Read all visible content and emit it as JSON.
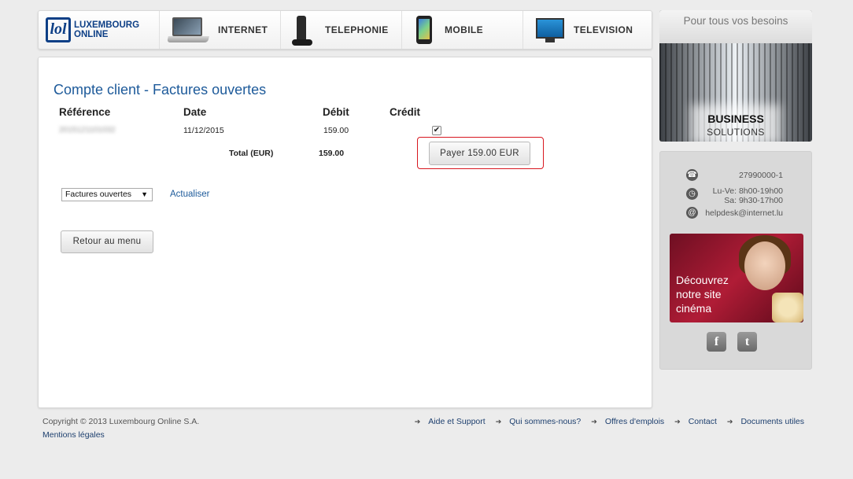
{
  "nav": {
    "logo_line1": "LUXEMBOURG",
    "logo_line2": "ONLINE",
    "logo_mark": "lol",
    "items": [
      {
        "label": "INTERNET",
        "icon": "laptop-icon"
      },
      {
        "label": "TELEPHONIE",
        "icon": "phone-icon"
      },
      {
        "label": "MOBILE",
        "icon": "mobile-icon"
      },
      {
        "label": "TELEVISION",
        "icon": "tv-icon"
      }
    ]
  },
  "main": {
    "title": "Compte client - Factures ouvertes",
    "table": {
      "headers": [
        "Référence",
        "Date",
        "Débit",
        "Crédit"
      ],
      "rows": [
        {
          "reference": "2015121101032",
          "date": "11/12/2015",
          "debit": "159.00",
          "credit_checked": true
        }
      ],
      "total_label": "Total (EUR)",
      "total_value": "159.00"
    },
    "pay_button": "Payer 159.00 EUR",
    "filter_select": "Factures ouvertes",
    "refresh_link": "Actualiser",
    "back_button": "Retour au menu"
  },
  "sidebar": {
    "banner_tagline": "Pour tous vos besoins",
    "banner_title": "BUSINESS",
    "banner_subtitle": "SOLUTIONS",
    "phone": "27990000-1",
    "hours_line1": "Lu-Ve: 8h00-19h00",
    "hours_line2": "Sa: 9h30-17h00",
    "email": "helpdesk@internet.lu",
    "cinema_line1": "Découvrez",
    "cinema_line2": "notre site",
    "cinema_line3": "cinéma",
    "facebook": "f",
    "twitter": "t"
  },
  "footer": {
    "copyright": "Copyright © 2013 Luxembourg Online S.A.",
    "legal": "Mentions légales",
    "links": [
      "Aide et Support",
      "Qui sommes-nous?",
      "Offres d'emplois",
      "Contact",
      "Documents utiles"
    ]
  },
  "colors": {
    "brand_blue": "#0d3f86",
    "title_blue": "#1d5a9a",
    "highlight_red": "#d8171f",
    "background": "#ececec"
  }
}
